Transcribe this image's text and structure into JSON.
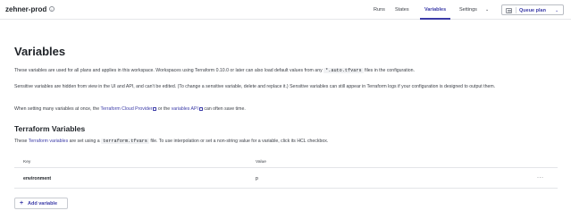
{
  "header": {
    "workspace_name": "zehner-prod",
    "info_glyph": "i",
    "nav": {
      "runs": "Runs",
      "states": "States",
      "variables": "Variables",
      "settings": "Settings",
      "active": "Variables"
    },
    "queue_plan_label": "Queue plan"
  },
  "main": {
    "title": "Variables",
    "intro_1a": "These variables are used for all plans and applies in this workspace. Workspaces using Terraform 0.10.0 or later can also load default values from any ",
    "intro_1_code": "*.auto.tfvars",
    "intro_1b": " files in the configuration.",
    "intro_2": "Sensitive variables are hidden from view in the UI and API, and can't be edited. (To change a sensitive variable, delete and replace it.) Sensitive variables can still appear in Terraform logs if your configuration is designed to output them.",
    "intro_3a": "When setting many variables at once, the ",
    "intro_3_link1": "Terraform Cloud Provider",
    "intro_3b": " or the ",
    "intro_3_link2": "variables API",
    "intro_3c": " can often save time.",
    "tf_section": {
      "title": "Terraform Variables",
      "desc_a": "These ",
      "desc_link": "Terraform variables",
      "desc_b": " are set using a ",
      "desc_code": "terraform.tfvars",
      "desc_c": " file. To use interpolation or set a non-string value for a variable, click its HCL checkbox."
    },
    "table": {
      "headers": {
        "key": "Key",
        "value": "Value"
      },
      "rows": [
        {
          "key": "environment",
          "value": "p",
          "menu": "···"
        }
      ]
    },
    "add_button": {
      "icon": "+",
      "label": "Add variable"
    }
  },
  "colors": {
    "accent": "#3c3ca8",
    "text": "#1f2328",
    "muted": "#3b3f46",
    "border": "#e3e5e8"
  }
}
